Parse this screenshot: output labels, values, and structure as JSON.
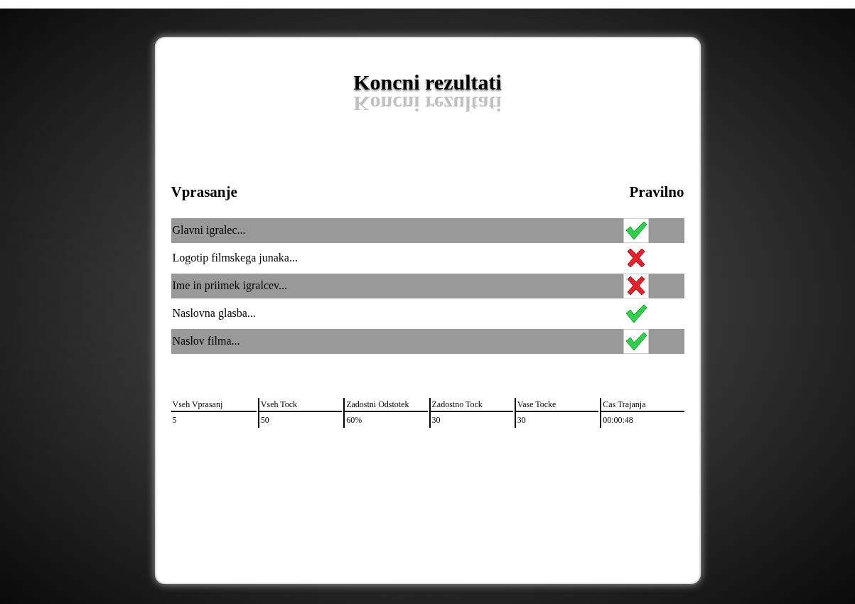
{
  "title": "Koncni rezultati",
  "title_reflection": "Koncni rezultati",
  "results": {
    "columns": [
      "Vprasanje",
      "Pravilno"
    ],
    "rows": [
      {
        "question": "Glavni igralec...",
        "correct": true
      },
      {
        "question": "Logotip filmskega junaka...",
        "correct": false
      },
      {
        "question": "Ime in priimek igralcev...",
        "correct": false
      },
      {
        "question": "Naslovna glasba...",
        "correct": true
      },
      {
        "question": "Naslov filma...",
        "correct": true
      }
    ]
  },
  "summary": {
    "columns": [
      "Vseh Vprasanj",
      "Vseh Tock",
      "Zadostni Odstotek",
      "Zadostno Tock",
      "Vase Tocke",
      "Cas Trajanja"
    ],
    "values": [
      "5",
      "50",
      "60%",
      "30",
      "30",
      "00:00:48"
    ]
  }
}
